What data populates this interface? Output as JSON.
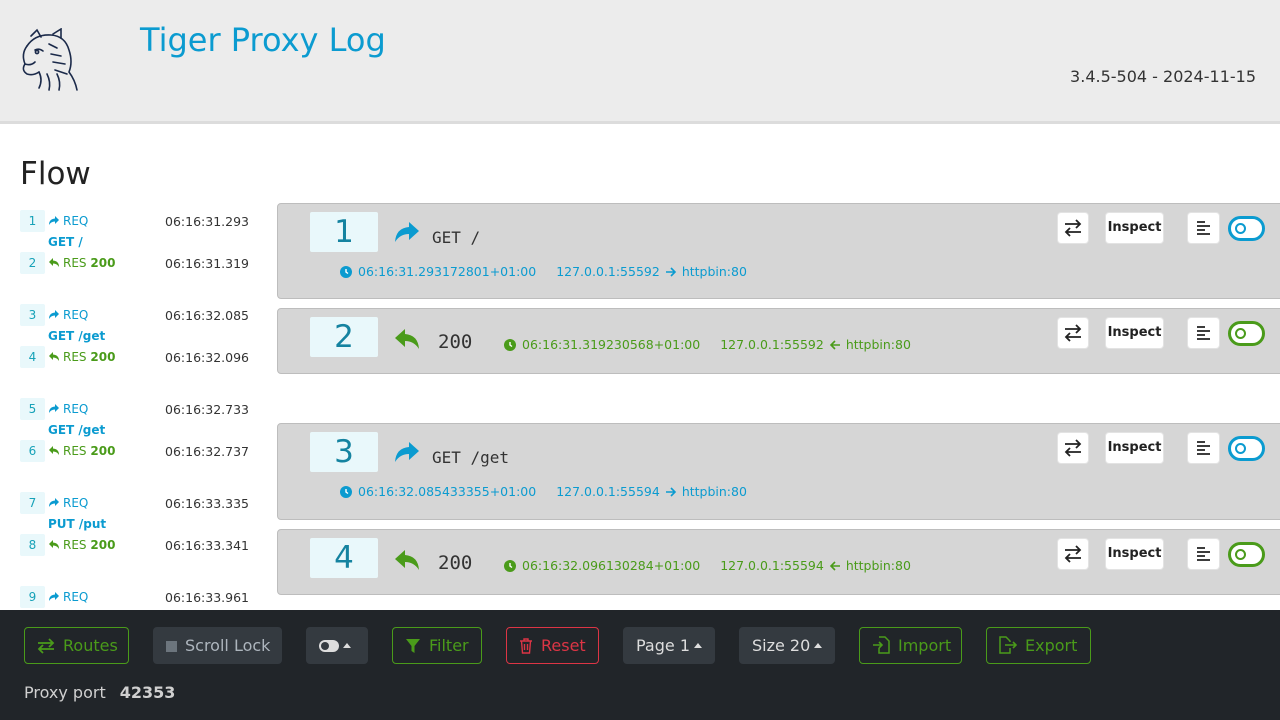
{
  "header": {
    "title": "Tiger Proxy Log",
    "version": "3.4.5-504 - 2024-11-15",
    "logo_icon": "tiger-logo-icon"
  },
  "flow_title": "Flow",
  "sidebar": [
    {
      "num": "1",
      "kind": "REQ",
      "label": "REQ",
      "time": "06:16:31.293",
      "path": "GET /"
    },
    {
      "num": "2",
      "kind": "RES",
      "label": "RES",
      "status": "200",
      "time": "06:16:31.319"
    },
    {
      "num": "3",
      "kind": "REQ",
      "label": "REQ",
      "time": "06:16:32.085",
      "path": "GET /get"
    },
    {
      "num": "4",
      "kind": "RES",
      "label": "RES",
      "status": "200",
      "time": "06:16:32.096"
    },
    {
      "num": "5",
      "kind": "REQ",
      "label": "REQ",
      "time": "06:16:32.733",
      "path": "GET /get"
    },
    {
      "num": "6",
      "kind": "RES",
      "label": "RES",
      "status": "200",
      "time": "06:16:32.737"
    },
    {
      "num": "7",
      "kind": "REQ",
      "label": "REQ",
      "time": "06:16:33.335",
      "path": "PUT /put"
    },
    {
      "num": "8",
      "kind": "RES",
      "label": "RES",
      "status": "200",
      "time": "06:16:33.341"
    },
    {
      "num": "9",
      "kind": "REQ",
      "label": "REQ",
      "time": "06:16:33.961"
    }
  ],
  "cards": [
    {
      "num": "1",
      "kind": "REQ",
      "method": "GET /",
      "timestamp": "06:16:31.293172801+01:00",
      "from": "127.0.0.1:55592",
      "to": "httpbin:80",
      "inspect": "Inspect"
    },
    {
      "num": "2",
      "kind": "RES",
      "status": "200",
      "timestamp": "06:16:31.319230568+01:00",
      "from": "127.0.0.1:55592",
      "to": "httpbin:80",
      "inspect": "Inspect"
    },
    {
      "num": "3",
      "kind": "REQ",
      "method": "GET /get",
      "timestamp": "06:16:32.085433355+01:00",
      "from": "127.0.0.1:55594",
      "to": "httpbin:80",
      "inspect": "Inspect"
    },
    {
      "num": "4",
      "kind": "RES",
      "status": "200",
      "timestamp": "06:16:32.096130284+01:00",
      "from": "127.0.0.1:55594",
      "to": "httpbin:80",
      "inspect": "Inspect"
    }
  ],
  "footer": {
    "routes": "Routes",
    "scroll_lock": "Scroll Lock",
    "filter": "Filter",
    "reset": "Reset",
    "page": "Page 1",
    "size": "Size 20",
    "import": "Import",
    "export": "Export",
    "proxy_port_label": "Proxy port",
    "proxy_port_value": "42353"
  },
  "colors": {
    "request": "#0b9bd0",
    "response": "#4a9b1a",
    "danger": "#dc3545",
    "footer_bg": "#212529"
  }
}
